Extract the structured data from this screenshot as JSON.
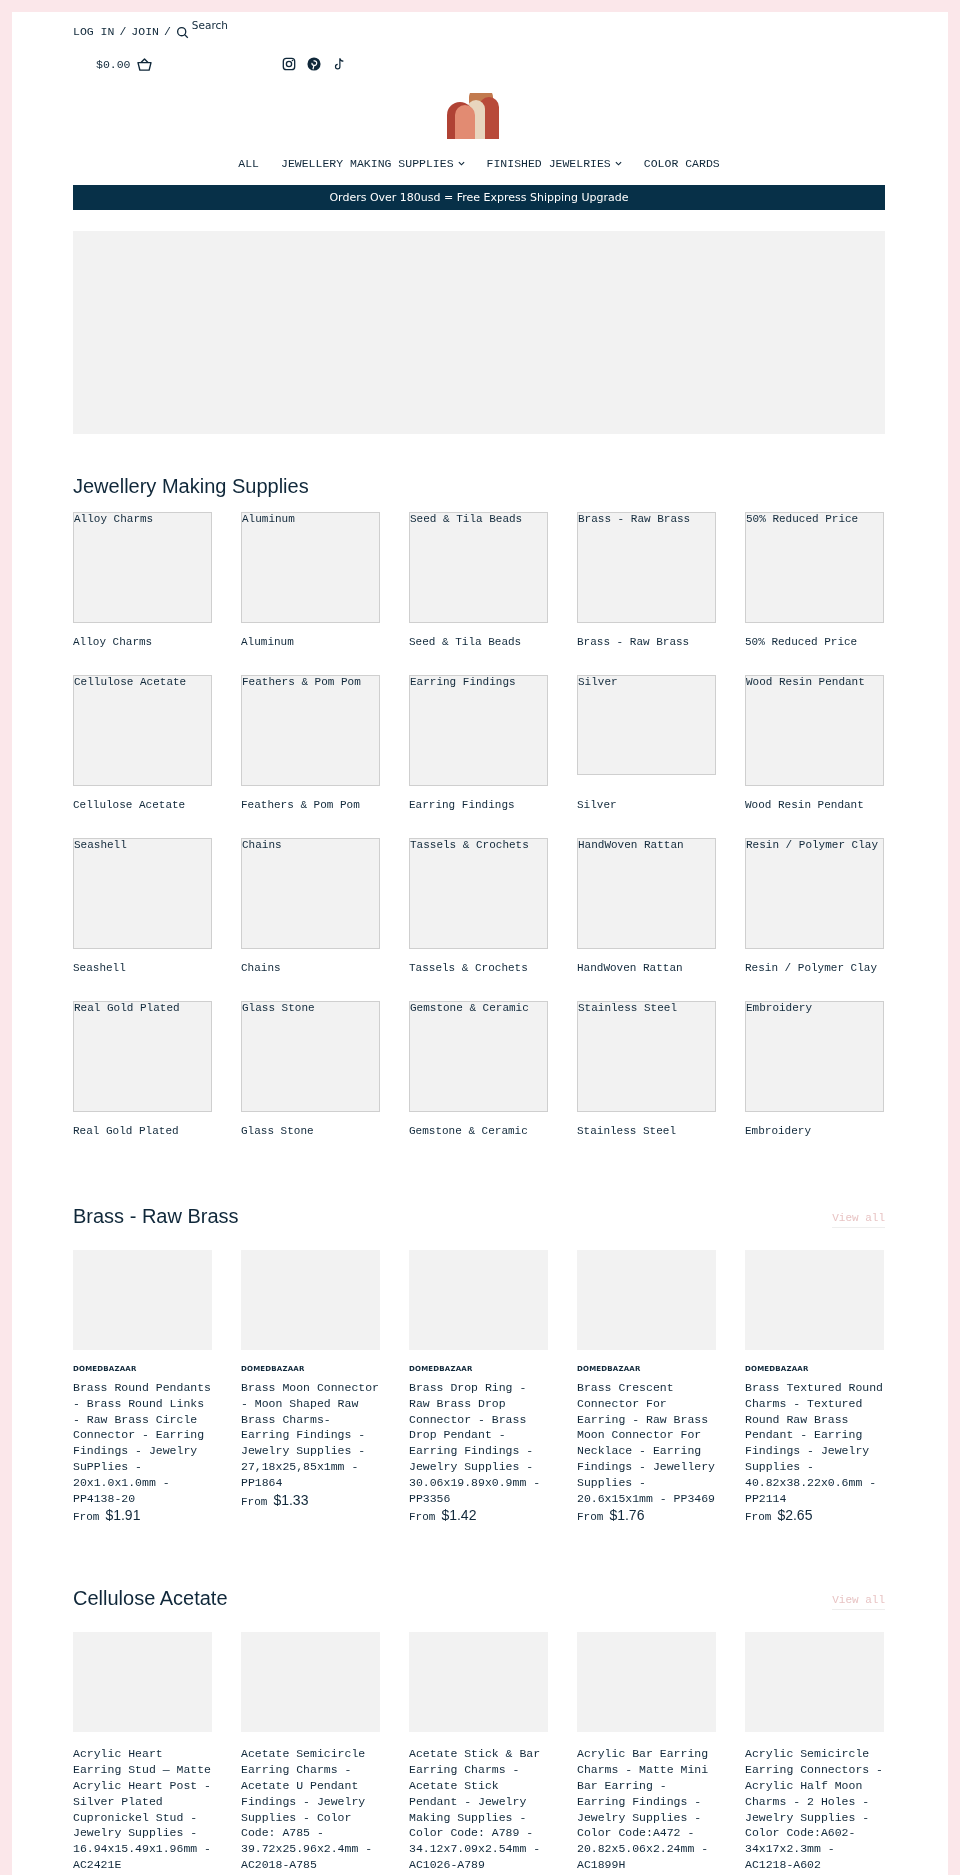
{
  "header": {
    "account_links": [
      {
        "label": "LOG IN"
      },
      {
        "label": "JOIN"
      }
    ],
    "separator": "/",
    "search_label": "Search",
    "cart_total": "$0.00"
  },
  "nav": [
    {
      "label": "ALL",
      "has_dropdown": false
    },
    {
      "label": "JEWELLERY MAKING SUPPLIES",
      "has_dropdown": true
    },
    {
      "label": "FINISHED JEWELRIES",
      "has_dropdown": true
    },
    {
      "label": "COLOR CARDS",
      "has_dropdown": false
    }
  ],
  "announcement": "Orders Over 180usd = Free Express Shipping Upgrade",
  "collections": {
    "title": "Jewellery Making Supplies",
    "items": [
      {
        "image_alt": "Alloy Charms",
        "label": "Alloy Charms"
      },
      {
        "image_alt": "Aluminum",
        "label": "Aluminum"
      },
      {
        "image_alt": "Seed & Tila Beads",
        "label": "Seed & Tila Beads"
      },
      {
        "image_alt": "Brass - Raw Brass",
        "label": "Brass - Raw Brass"
      },
      {
        "image_alt": "50% Reduced Price",
        "label": "50% Reduced Price"
      },
      {
        "image_alt": "Cellulose Acetate",
        "label": "Cellulose Acetate"
      },
      {
        "image_alt": "Feathers & Pom Pom",
        "label": "Feathers & Pom Pom"
      },
      {
        "image_alt": "Earring Findings",
        "label": "Earring Findings"
      },
      {
        "image_alt": "Silver",
        "label": "Silver"
      },
      {
        "image_alt": "Wood Resin Pendant",
        "label": "Wood Resin Pendant"
      },
      {
        "image_alt": "Seashell",
        "label": "Seashell"
      },
      {
        "image_alt": "Chains",
        "label": "Chains"
      },
      {
        "image_alt": "Tassels & Crochets",
        "label": "Tassels & Crochets"
      },
      {
        "image_alt": "HandWoven Rattan",
        "label": "HandWoven Rattan"
      },
      {
        "image_alt": "Resin / Polymer Clay",
        "label": "Resin / Polymer Clay"
      },
      {
        "image_alt": "Real Gold Plated",
        "label": "Real Gold Plated"
      },
      {
        "image_alt": "Glass Stone",
        "label": "Glass Stone"
      },
      {
        "image_alt": "Gemstone & Ceramic",
        "label": "Gemstone & Ceramic"
      },
      {
        "image_alt": "Stainless Steel",
        "label": "Stainless Steel"
      },
      {
        "image_alt": "Embroidery",
        "label": "Embroidery"
      }
    ]
  },
  "product_sections": [
    {
      "title": "Brass - Raw Brass",
      "view_all": "View all",
      "products": [
        {
          "vendor": "DOMEDBAZAAR",
          "title": "Brass Round Pendants - Brass Round Links - Raw Brass Circle Connector - Earring Findings - Jewelry SuPPlies - 20x1.0x1.0mm - PP4138-20",
          "price_prefix": "From",
          "price": "$1.91"
        },
        {
          "vendor": "DOMEDBAZAAR",
          "title": "Brass Moon Connector - Moon Shaped Raw Brass Charms- Earring Findings - Jewelry Supplies - 27,18x25,85x1mm - PP1864",
          "price_prefix": "From",
          "price": "$1.33"
        },
        {
          "vendor": "DOMEDBAZAAR",
          "title": "Brass Drop Ring - Raw Brass Drop Connector - Brass Drop Pendant - Earring Findings - Jewelry Supplies - 30.06x19.89x0.9mm - PP3356",
          "price_prefix": "From",
          "price": "$1.42"
        },
        {
          "vendor": "DOMEDBAZAAR",
          "title": "Brass Crescent Connector For Earring - Raw Brass Moon Connector For Necklace - Earring Findings - Jewellery Supplies - 20.6x15x1mm - PP3469",
          "price_prefix": "From",
          "price": "$1.76"
        },
        {
          "vendor": "DOMEDBAZAAR",
          "title": "Brass Textured Round Charms - Textured Round Raw Brass Pendant - Earring Findings - Jewelry Supplies - 40.82x38.22x0.6mm - PP2114",
          "price_prefix": "From",
          "price": "$2.65"
        }
      ]
    },
    {
      "title": "Cellulose Acetate",
      "view_all": "View all",
      "products": [
        {
          "title": "Acrylic Heart Earring Stud — Matte Acrylic Heart Post - Silver Plated Cupronickel Stud - Jewelry Supplies - 16.94x15.49x1.96mm - AC2421E"
        },
        {
          "title": "Acetate Semicircle Earring Charms - Acetate U Pendant Findings - Jewelry Supplies - Color Code: A785 - 39.72x25.96x2.4mm - AC2018-A785"
        },
        {
          "title": "Acetate Stick & Bar Earring Charms - Acetate Stick Pendant - Jewelry Making Supplies - Color Code: A789 - 34.12x7.09x2.54mm - AC1026-A789"
        },
        {
          "title": "Acrylic Bar Earring Charms - Matte Mini Bar Earring - Earring Findings - Jewelry Supplies - Color Code:A472 - 20.82x5.06x2.24mm - AC1899H"
        },
        {
          "title": "Acrylic Semicircle Earring Connectors - Acrylic Half Moon Charms - 2 Holes - Jewelry Supplies - Color Code:A602-34x17x2.3mm - AC1218-A602"
        }
      ]
    }
  ]
}
